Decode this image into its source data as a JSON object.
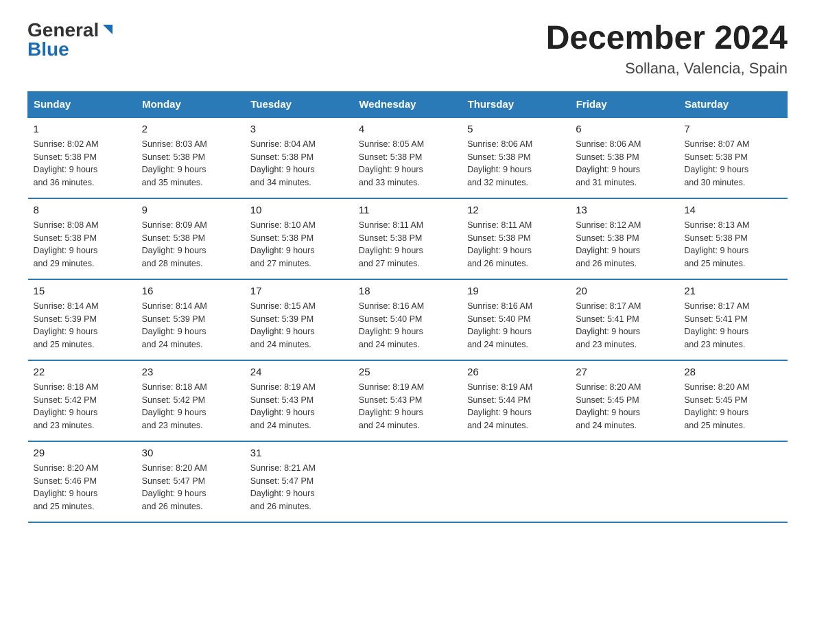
{
  "header": {
    "logo_general": "General",
    "logo_blue": "Blue",
    "month_title": "December 2024",
    "subtitle": "Sollana, Valencia, Spain"
  },
  "days_of_week": [
    "Sunday",
    "Monday",
    "Tuesday",
    "Wednesday",
    "Thursday",
    "Friday",
    "Saturday"
  ],
  "weeks": [
    [
      {
        "day": "1",
        "sunrise": "8:02 AM",
        "sunset": "5:38 PM",
        "daylight": "9 hours and 36 minutes."
      },
      {
        "day": "2",
        "sunrise": "8:03 AM",
        "sunset": "5:38 PM",
        "daylight": "9 hours and 35 minutes."
      },
      {
        "day": "3",
        "sunrise": "8:04 AM",
        "sunset": "5:38 PM",
        "daylight": "9 hours and 34 minutes."
      },
      {
        "day": "4",
        "sunrise": "8:05 AM",
        "sunset": "5:38 PM",
        "daylight": "9 hours and 33 minutes."
      },
      {
        "day": "5",
        "sunrise": "8:06 AM",
        "sunset": "5:38 PM",
        "daylight": "9 hours and 32 minutes."
      },
      {
        "day": "6",
        "sunrise": "8:06 AM",
        "sunset": "5:38 PM",
        "daylight": "9 hours and 31 minutes."
      },
      {
        "day": "7",
        "sunrise": "8:07 AM",
        "sunset": "5:38 PM",
        "daylight": "9 hours and 30 minutes."
      }
    ],
    [
      {
        "day": "8",
        "sunrise": "8:08 AM",
        "sunset": "5:38 PM",
        "daylight": "9 hours and 29 minutes."
      },
      {
        "day": "9",
        "sunrise": "8:09 AM",
        "sunset": "5:38 PM",
        "daylight": "9 hours and 28 minutes."
      },
      {
        "day": "10",
        "sunrise": "8:10 AM",
        "sunset": "5:38 PM",
        "daylight": "9 hours and 27 minutes."
      },
      {
        "day": "11",
        "sunrise": "8:11 AM",
        "sunset": "5:38 PM",
        "daylight": "9 hours and 27 minutes."
      },
      {
        "day": "12",
        "sunrise": "8:11 AM",
        "sunset": "5:38 PM",
        "daylight": "9 hours and 26 minutes."
      },
      {
        "day": "13",
        "sunrise": "8:12 AM",
        "sunset": "5:38 PM",
        "daylight": "9 hours and 26 minutes."
      },
      {
        "day": "14",
        "sunrise": "8:13 AM",
        "sunset": "5:38 PM",
        "daylight": "9 hours and 25 minutes."
      }
    ],
    [
      {
        "day": "15",
        "sunrise": "8:14 AM",
        "sunset": "5:39 PM",
        "daylight": "9 hours and 25 minutes."
      },
      {
        "day": "16",
        "sunrise": "8:14 AM",
        "sunset": "5:39 PM",
        "daylight": "9 hours and 24 minutes."
      },
      {
        "day": "17",
        "sunrise": "8:15 AM",
        "sunset": "5:39 PM",
        "daylight": "9 hours and 24 minutes."
      },
      {
        "day": "18",
        "sunrise": "8:16 AM",
        "sunset": "5:40 PM",
        "daylight": "9 hours and 24 minutes."
      },
      {
        "day": "19",
        "sunrise": "8:16 AM",
        "sunset": "5:40 PM",
        "daylight": "9 hours and 24 minutes."
      },
      {
        "day": "20",
        "sunrise": "8:17 AM",
        "sunset": "5:41 PM",
        "daylight": "9 hours and 23 minutes."
      },
      {
        "day": "21",
        "sunrise": "8:17 AM",
        "sunset": "5:41 PM",
        "daylight": "9 hours and 23 minutes."
      }
    ],
    [
      {
        "day": "22",
        "sunrise": "8:18 AM",
        "sunset": "5:42 PM",
        "daylight": "9 hours and 23 minutes."
      },
      {
        "day": "23",
        "sunrise": "8:18 AM",
        "sunset": "5:42 PM",
        "daylight": "9 hours and 23 minutes."
      },
      {
        "day": "24",
        "sunrise": "8:19 AM",
        "sunset": "5:43 PM",
        "daylight": "9 hours and 24 minutes."
      },
      {
        "day": "25",
        "sunrise": "8:19 AM",
        "sunset": "5:43 PM",
        "daylight": "9 hours and 24 minutes."
      },
      {
        "day": "26",
        "sunrise": "8:19 AM",
        "sunset": "5:44 PM",
        "daylight": "9 hours and 24 minutes."
      },
      {
        "day": "27",
        "sunrise": "8:20 AM",
        "sunset": "5:45 PM",
        "daylight": "9 hours and 24 minutes."
      },
      {
        "day": "28",
        "sunrise": "8:20 AM",
        "sunset": "5:45 PM",
        "daylight": "9 hours and 25 minutes."
      }
    ],
    [
      {
        "day": "29",
        "sunrise": "8:20 AM",
        "sunset": "5:46 PM",
        "daylight": "9 hours and 25 minutes."
      },
      {
        "day": "30",
        "sunrise": "8:20 AM",
        "sunset": "5:47 PM",
        "daylight": "9 hours and 26 minutes."
      },
      {
        "day": "31",
        "sunrise": "8:21 AM",
        "sunset": "5:47 PM",
        "daylight": "9 hours and 26 minutes."
      },
      null,
      null,
      null,
      null
    ]
  ],
  "labels": {
    "sunrise": "Sunrise:",
    "sunset": "Sunset:",
    "daylight": "Daylight:"
  },
  "colors": {
    "header_bg": "#2a7ab8",
    "header_text": "#ffffff",
    "border": "#2a7ab8"
  }
}
